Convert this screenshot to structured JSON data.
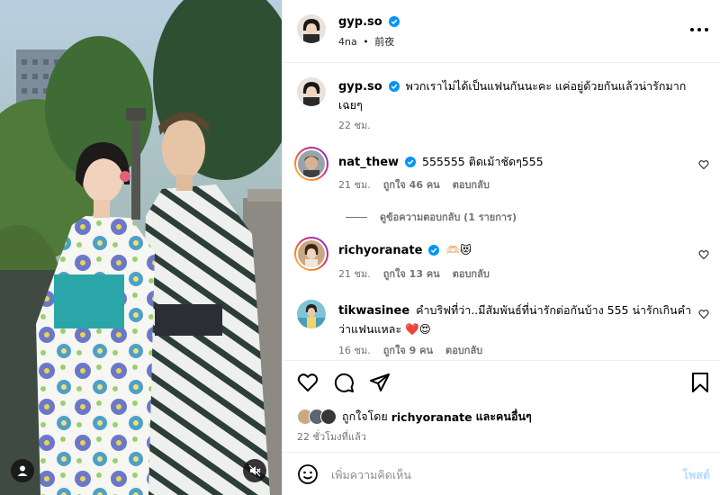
{
  "post": {
    "author": "gyp.so",
    "age": "4na",
    "dot": "•",
    "location": "前夜"
  },
  "caption": {
    "username": "gyp.so",
    "text": "พวกเราไม่ได้เป็นแฟนกันนะคะ แค่อยู่ด้วยกันแล้วน่ารักมาก เฉยๆ",
    "time": "22 ชม."
  },
  "comments": [
    {
      "username": "nat_thew",
      "verified": true,
      "text": "555555 ติดเม้าชัดๆ555",
      "time": "21 ชม.",
      "likes": "ถูกใจ 46 คน",
      "reply": "ตอบกลับ"
    },
    {
      "username": "richyoranate",
      "verified": true,
      "text": "🫶🏻😻",
      "time": "21 ชม.",
      "likes": "ถูกใจ 13 คน",
      "reply": "ตอบกลับ"
    },
    {
      "username": "tikwasinee",
      "verified": false,
      "text": "คำบริฟที่ว่า..มีสัมพันธ์ที่น่ารักต่อกันบ้าง 555 น่ารักเกินคำว่าแฟนแหละ ❤️😍",
      "time": "16 ชม.",
      "likes": "ถูกใจ 9 คน",
      "reply": "ตอบกลับ"
    }
  ],
  "view_replies": "ดูข้อความตอบกลับ (1 รายการ)",
  "liked_by": {
    "prefix": "ถูกใจโดย",
    "user": "richyoranate",
    "suffix": "และคนอื่นๆ"
  },
  "posted_time": "22 ชั่วโมงที่แล้ว",
  "add_comment": {
    "placeholder": "เพิ่มความคิดเห็น",
    "post_label": "โพสต์"
  },
  "icons": {
    "like": "heart-icon",
    "comment": "comment-icon",
    "share": "send-icon",
    "save": "bookmark-icon",
    "emoji": "smiley-icon",
    "more": "more-icon",
    "tag": "user-tag-icon",
    "mute": "muted-speaker-icon"
  },
  "colors": {
    "verified": "#0095f6",
    "post_button_disabled": "#b3dbff",
    "muted_text": "#737373",
    "border": "#efefef"
  }
}
